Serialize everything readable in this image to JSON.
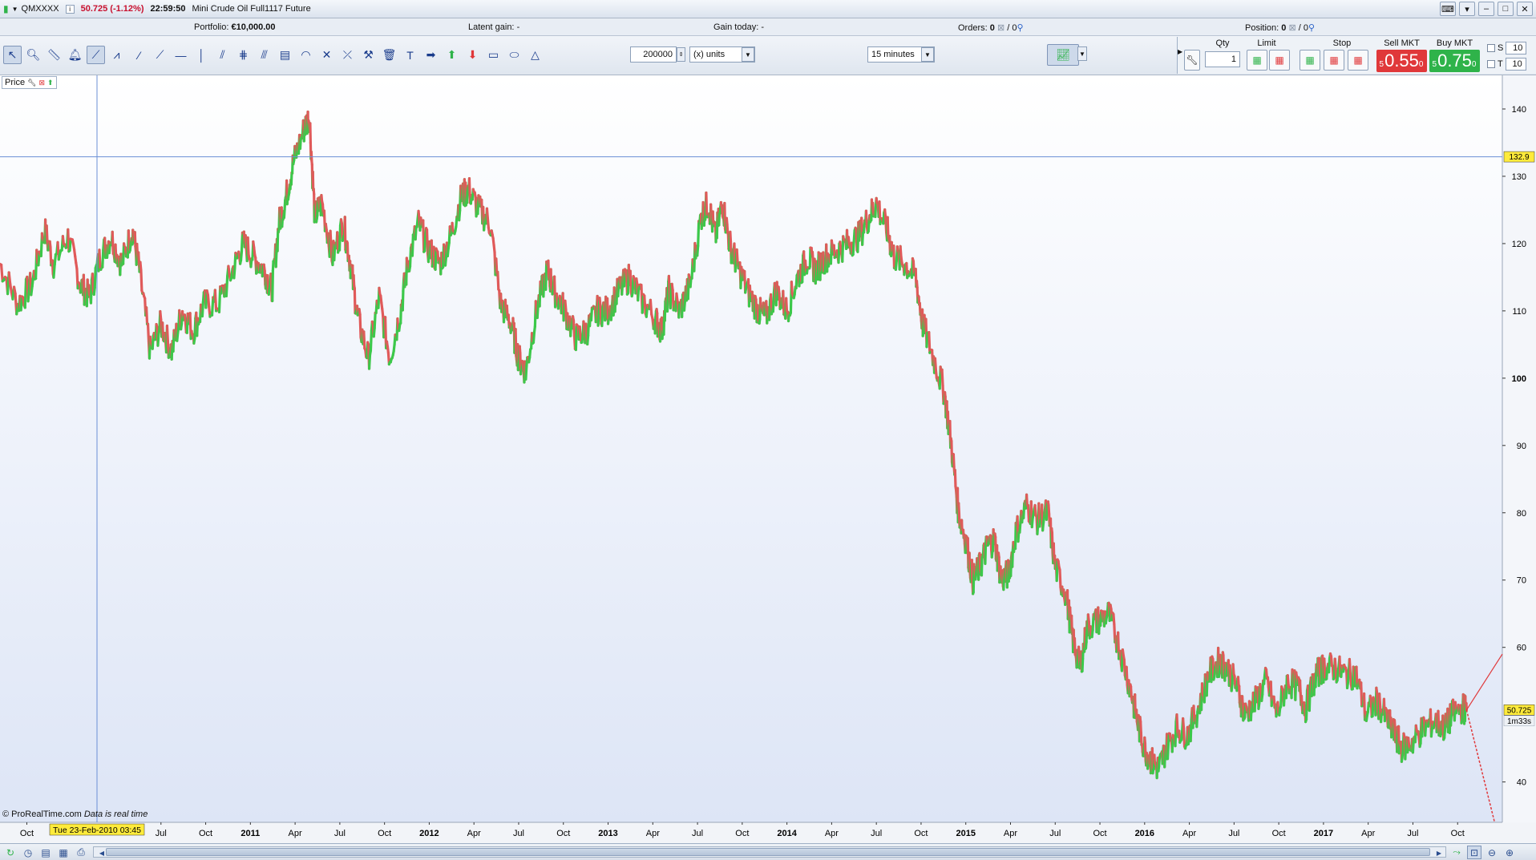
{
  "titlebar": {
    "symbol": "QMXXXX",
    "price_change": "50.725 (-1.12%)",
    "time": "22:59:50",
    "instrument": "Mini Crude Oil Full1117 Future"
  },
  "portfolio": {
    "portfolio_label": "Portfolio:",
    "portfolio_value": "€10,000.00",
    "latent_label": "Latent gain:",
    "latent_value": "-",
    "gain_today_label": "Gain today:",
    "gain_today_value": "-",
    "orders_label": "Orders:",
    "orders_value_a": "0",
    "orders_value_b": "/ 0",
    "position_label": "Position:",
    "position_value": "0",
    "position_value_b": "/ 0"
  },
  "toolbar": {
    "quantity_value": "200000",
    "units_value": "(x) units",
    "timeframe_value": "15 minutes"
  },
  "order_panel": {
    "qty_label": "Qty",
    "qty_value": "1",
    "limit_label": "Limit",
    "stop_label": "Stop",
    "sell_label": "Sell MKT",
    "sell_price": "0.55",
    "sell_prefix": "5",
    "sell_suffix": "0",
    "buy_label": "Buy MKT",
    "buy_price": "0.75",
    "buy_prefix": "5",
    "buy_suffix": "0",
    "s_label": "S",
    "s_value": "10",
    "t_label": "T",
    "t_value": "10",
    "colors": {
      "sell": "#e0383a",
      "buy": "#2fb34a"
    }
  },
  "chart_header": {
    "label": "Price"
  },
  "credit": {
    "site": "© ProRealTime.com",
    "note": "Data is real time"
  },
  "chart_data": {
    "type": "line",
    "ylim": [
      34,
      145
    ],
    "y_ticks": [
      "140",
      "130",
      "120",
      "110",
      "100",
      "90",
      "80",
      "70",
      "60",
      "40"
    ],
    "y_tick_values": [
      140,
      130,
      120,
      110,
      100,
      90,
      80,
      70,
      60,
      40
    ],
    "x_ticks": [
      {
        "label": "Oct",
        "t": 2009.75,
        "bold": false
      },
      {
        "label": "Jul",
        "t": 2010.5,
        "bold": false
      },
      {
        "label": "Oct",
        "t": 2010.75,
        "bold": false
      },
      {
        "label": "2011",
        "t": 2011.0,
        "bold": true
      },
      {
        "label": "Apr",
        "t": 2011.25,
        "bold": false
      },
      {
        "label": "Jul",
        "t": 2011.5,
        "bold": false
      },
      {
        "label": "Oct",
        "t": 2011.75,
        "bold": false
      },
      {
        "label": "2012",
        "t": 2012.0,
        "bold": true
      },
      {
        "label": "Apr",
        "t": 2012.25,
        "bold": false
      },
      {
        "label": "Jul",
        "t": 2012.5,
        "bold": false
      },
      {
        "label": "Oct",
        "t": 2012.75,
        "bold": false
      },
      {
        "label": "2013",
        "t": 2013.0,
        "bold": true
      },
      {
        "label": "Apr",
        "t": 2013.25,
        "bold": false
      },
      {
        "label": "Jul",
        "t": 2013.5,
        "bold": false
      },
      {
        "label": "Oct",
        "t": 2013.75,
        "bold": false
      },
      {
        "label": "2014",
        "t": 2014.0,
        "bold": true
      },
      {
        "label": "Apr",
        "t": 2014.25,
        "bold": false
      },
      {
        "label": "Jul",
        "t": 2014.5,
        "bold": false
      },
      {
        "label": "Oct",
        "t": 2014.75,
        "bold": false
      },
      {
        "label": "2015",
        "t": 2015.0,
        "bold": true
      },
      {
        "label": "Apr",
        "t": 2015.25,
        "bold": false
      },
      {
        "label": "Jul",
        "t": 2015.5,
        "bold": false
      },
      {
        "label": "Oct",
        "t": 2015.75,
        "bold": false
      },
      {
        "label": "2016",
        "t": 2016.0,
        "bold": true
      },
      {
        "label": "Apr",
        "t": 2016.25,
        "bold": false
      },
      {
        "label": "Jul",
        "t": 2016.5,
        "bold": false
      },
      {
        "label": "Oct",
        "t": 2016.75,
        "bold": false
      },
      {
        "label": "2017",
        "t": 2017.0,
        "bold": true
      },
      {
        "label": "Apr",
        "t": 2017.25,
        "bold": false
      },
      {
        "label": "Jul",
        "t": 2017.5,
        "bold": false
      },
      {
        "label": "Oct",
        "t": 2017.75,
        "bold": false
      }
    ],
    "xlim": [
      2009.6,
      2018.0
    ],
    "series": [
      {
        "points": [
          [
            2009.6,
            117
          ],
          [
            2009.7,
            111
          ],
          [
            2009.78,
            114
          ],
          [
            2009.85,
            122
          ],
          [
            2009.9,
            117
          ],
          [
            2009.98,
            121
          ],
          [
            2010.05,
            114
          ],
          [
            2010.1,
            112
          ],
          [
            2010.16,
            118
          ],
          [
            2010.22,
            121
          ],
          [
            2010.28,
            117
          ],
          [
            2010.34,
            122
          ],
          [
            2010.38,
            116
          ],
          [
            2010.44,
            104
          ],
          [
            2010.5,
            108
          ],
          [
            2010.56,
            104
          ],
          [
            2010.62,
            110
          ],
          [
            2010.68,
            107
          ],
          [
            2010.74,
            111
          ],
          [
            2010.82,
            111
          ],
          [
            2010.9,
            116
          ],
          [
            2010.96,
            120
          ],
          [
            2011.02,
            118
          ],
          [
            2011.08,
            116
          ],
          [
            2011.12,
            113
          ],
          [
            2011.16,
            123
          ],
          [
            2011.2,
            127
          ],
          [
            2011.24,
            132
          ],
          [
            2011.3,
            137
          ],
          [
            2011.33,
            139
          ],
          [
            2011.36,
            124
          ],
          [
            2011.4,
            126
          ],
          [
            2011.46,
            118
          ],
          [
            2011.52,
            123
          ],
          [
            2011.56,
            117
          ],
          [
            2011.6,
            109
          ],
          [
            2011.66,
            103
          ],
          [
            2011.72,
            112
          ],
          [
            2011.78,
            103
          ],
          [
            2011.84,
            110
          ],
          [
            2011.88,
            117
          ],
          [
            2011.94,
            123
          ],
          [
            2012.0,
            119
          ],
          [
            2012.06,
            117
          ],
          [
            2012.12,
            121
          ],
          [
            2012.18,
            127
          ],
          [
            2012.22,
            128
          ],
          [
            2012.28,
            125
          ],
          [
            2012.34,
            123
          ],
          [
            2012.4,
            111
          ],
          [
            2012.46,
            108
          ],
          [
            2012.5,
            103
          ],
          [
            2012.54,
            101
          ],
          [
            2012.6,
            110
          ],
          [
            2012.66,
            116
          ],
          [
            2012.7,
            113
          ],
          [
            2012.76,
            110
          ],
          [
            2012.82,
            106
          ],
          [
            2012.88,
            107
          ],
          [
            2012.94,
            110
          ],
          [
            2013.0,
            110
          ],
          [
            2013.06,
            113
          ],
          [
            2013.12,
            115
          ],
          [
            2013.18,
            112
          ],
          [
            2013.26,
            109
          ],
          [
            2013.3,
            107
          ],
          [
            2013.34,
            113
          ],
          [
            2013.4,
            110
          ],
          [
            2013.46,
            114
          ],
          [
            2013.52,
            124
          ],
          [
            2013.56,
            126
          ],
          [
            2013.6,
            121
          ],
          [
            2013.64,
            126
          ],
          [
            2013.68,
            120
          ],
          [
            2013.72,
            117
          ],
          [
            2013.78,
            113
          ],
          [
            2013.84,
            110
          ],
          [
            2013.88,
            109
          ],
          [
            2013.94,
            113
          ],
          [
            2014.0,
            110
          ],
          [
            2014.06,
            115
          ],
          [
            2014.12,
            118
          ],
          [
            2014.16,
            116
          ],
          [
            2014.22,
            118
          ],
          [
            2014.28,
            119
          ],
          [
            2014.34,
            120
          ],
          [
            2014.4,
            121
          ],
          [
            2014.46,
            124
          ],
          [
            2014.5,
            126
          ],
          [
            2014.56,
            122
          ],
          [
            2014.6,
            118
          ],
          [
            2014.66,
            117
          ],
          [
            2014.72,
            115
          ],
          [
            2014.76,
            108
          ],
          [
            2014.82,
            103
          ],
          [
            2014.88,
            98
          ],
          [
            2014.92,
            90
          ],
          [
            2014.96,
            80
          ],
          [
            2015.0,
            76
          ],
          [
            2015.04,
            70
          ],
          [
            2015.08,
            72
          ],
          [
            2015.12,
            75
          ],
          [
            2015.16,
            76
          ],
          [
            2015.2,
            70
          ],
          [
            2015.24,
            71
          ],
          [
            2015.28,
            77
          ],
          [
            2015.34,
            81
          ],
          [
            2015.4,
            79
          ],
          [
            2015.46,
            80
          ],
          [
            2015.5,
            72
          ],
          [
            2015.56,
            68
          ],
          [
            2015.6,
            61
          ],
          [
            2015.64,
            57
          ],
          [
            2015.68,
            63
          ],
          [
            2015.74,
            64
          ],
          [
            2015.8,
            65
          ],
          [
            2015.86,
            60
          ],
          [
            2015.92,
            54
          ],
          [
            2015.96,
            49
          ],
          [
            2016.0,
            45
          ],
          [
            2016.04,
            43
          ],
          [
            2016.08,
            42
          ],
          [
            2016.12,
            45
          ],
          [
            2016.18,
            48
          ],
          [
            2016.24,
            47
          ],
          [
            2016.3,
            51
          ],
          [
            2016.36,
            56
          ],
          [
            2016.42,
            58
          ],
          [
            2016.46,
            57
          ],
          [
            2016.52,
            54
          ],
          [
            2016.56,
            50
          ],
          [
            2016.62,
            52
          ],
          [
            2016.68,
            55
          ],
          [
            2016.74,
            50
          ],
          [
            2016.8,
            55
          ],
          [
            2016.86,
            54
          ],
          [
            2016.9,
            51
          ],
          [
            2016.96,
            56
          ],
          [
            2017.0,
            57
          ],
          [
            2017.06,
            57
          ],
          [
            2017.12,
            56
          ],
          [
            2017.18,
            56
          ],
          [
            2017.24,
            50
          ],
          [
            2017.3,
            52
          ],
          [
            2017.36,
            49
          ],
          [
            2017.4,
            47
          ],
          [
            2017.44,
            45
          ],
          [
            2017.5,
            46
          ],
          [
            2017.56,
            48
          ],
          [
            2017.62,
            49
          ],
          [
            2017.68,
            48
          ],
          [
            2017.72,
            50
          ],
          [
            2017.78,
            51
          ],
          [
            2017.8,
            50.7
          ]
        ]
      }
    ],
    "hline_value": 132.9,
    "hline_label": "132.9",
    "last_price_label": "50.725",
    "countdown_label": "1m33s",
    "crosshair_date_label": "Tue 23-Feb-2010 03:45",
    "colors": {
      "up": "#3cc84a",
      "down": "#e05a5a",
      "bg_top": "#ffffff",
      "bg_bottom": "#dde5f6",
      "hline": "#6b8fd6"
    }
  }
}
